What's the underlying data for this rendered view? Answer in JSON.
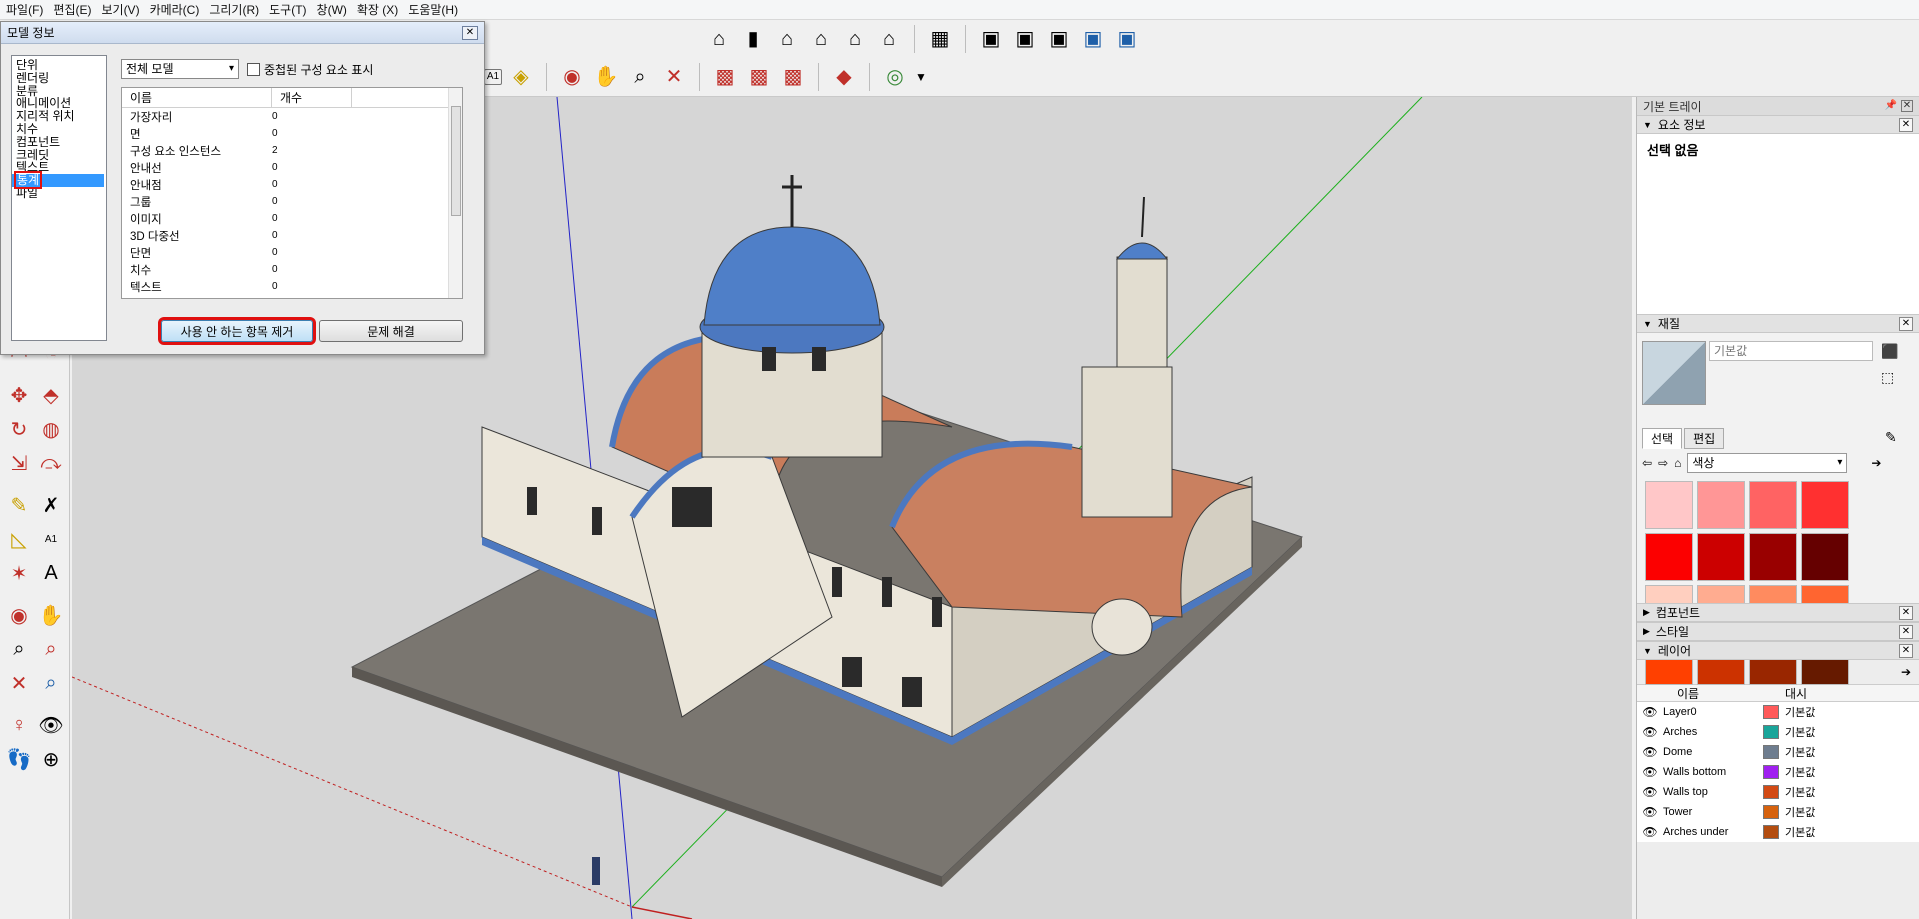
{
  "menu": [
    "파일(F)",
    "편집(E)",
    "보기(V)",
    "카메라(C)",
    "그리기(R)",
    "도구(T)",
    "창(W)",
    "확장 (X)",
    "도움말(H)"
  ],
  "toolbar_top": {
    "views": [
      "iso-view-icon",
      "top-view-icon",
      "front-view-icon",
      "right-view-icon",
      "back-view-icon",
      "left-view-icon"
    ],
    "styles": [
      "xray-style-icon",
      "back-edges-style-icon",
      "wireframe-style-icon",
      "hidden-line-style-icon",
      "shaded-style-icon",
      "shaded-textures-style-icon",
      "monochrome-style-icon"
    ]
  },
  "toolbar_second": [
    "text-tool-icon",
    "paint-bucket-icon",
    "orbit-icon",
    "pan-icon",
    "zoom-icon",
    "zoom-extents-icon",
    "warehouse-icon",
    "share-model-icon",
    "upload-component-icon",
    "extension-warehouse-icon",
    "account-icon"
  ],
  "left_tools": [
    "arc-icon",
    "pie-icon",
    "move-icon",
    "push-pull-icon",
    "rotate-icon",
    "follow-me-icon",
    "scale-icon",
    "offset-icon",
    "tape-measure-icon",
    "dimension-icon",
    "protractor-icon",
    "text-icon",
    "axes-icon",
    "3d-text-icon",
    "orbit-icon",
    "pan-icon",
    "zoom-icon",
    "zoom-window-icon",
    "zoom-extents-icon",
    "previous-view-icon",
    "position-camera-icon",
    "look-around-icon",
    "walk-icon",
    "section-plane-icon"
  ],
  "dialog": {
    "title": "모델 정보",
    "categories": [
      "단위",
      "렌더링",
      "분류",
      "애니메이션",
      "지리적 위치",
      "치수",
      "컴포넌트",
      "크레딧",
      "텍스트",
      "통계",
      "파일"
    ],
    "selected_category": "통계",
    "scope": "전체 모델",
    "nested_label": "중첩된 구성 요소 표시",
    "col_name": "이름",
    "col_count": "개수",
    "rows": [
      {
        "name": "가장자리",
        "count": "0"
      },
      {
        "name": "면",
        "count": "0"
      },
      {
        "name": "구성 요소 인스턴스",
        "count": "2"
      },
      {
        "name": "안내선",
        "count": "0"
      },
      {
        "name": "안내점",
        "count": "0"
      },
      {
        "name": "그룹",
        "count": "0"
      },
      {
        "name": "이미지",
        "count": "0"
      },
      {
        "name": "3D 다중선",
        "count": "0"
      },
      {
        "name": "단면",
        "count": "0"
      },
      {
        "name": "치수",
        "count": "0"
      },
      {
        "name": "텍스트",
        "count": "0"
      }
    ],
    "purge_btn": "사용 안 하는 항목 제거",
    "fix_btn": "문제 해결"
  },
  "tray": {
    "title": "기본 트레이",
    "entity_info": {
      "label": "요소 정보",
      "text": "선택 없음"
    },
    "materials": {
      "label": "재질",
      "name": "기본값",
      "tab_select": "선택",
      "tab_edit": "편집",
      "library": "색상",
      "swatches": [
        "#ffc7c8",
        "#ff9696",
        "#ff6363",
        "#ff3030",
        "#fc0000",
        "#cc0000",
        "#990000",
        "#650000",
        "#ffcfbf",
        "#ffac90",
        "#ff8b5f",
        "#ff6530",
        "#ff4000",
        "#cc3200",
        "#992600",
        "#661a00"
      ]
    },
    "components_label": "컴포넌트",
    "styles_label": "스타일",
    "layers": {
      "label": "레이어",
      "col_name": "이름",
      "col_style": "대시",
      "rows": [
        {
          "name": "Layer0",
          "color": "#ff5a5a",
          "style": "기본값"
        },
        {
          "name": "Arches",
          "color": "#1aa59a",
          "style": "기본값"
        },
        {
          "name": "Dome",
          "color": "#6e7d8f",
          "style": "기본값"
        },
        {
          "name": "Walls bottom",
          "color": "#a020f0",
          "style": "기본값"
        },
        {
          "name": "Walls top",
          "color": "#d24a14",
          "style": "기본값"
        },
        {
          "name": "Tower",
          "color": "#d6620e",
          "style": "기본값"
        },
        {
          "name": "Arches under",
          "color": "#b34d10",
          "style": "기본값"
        }
      ]
    }
  }
}
